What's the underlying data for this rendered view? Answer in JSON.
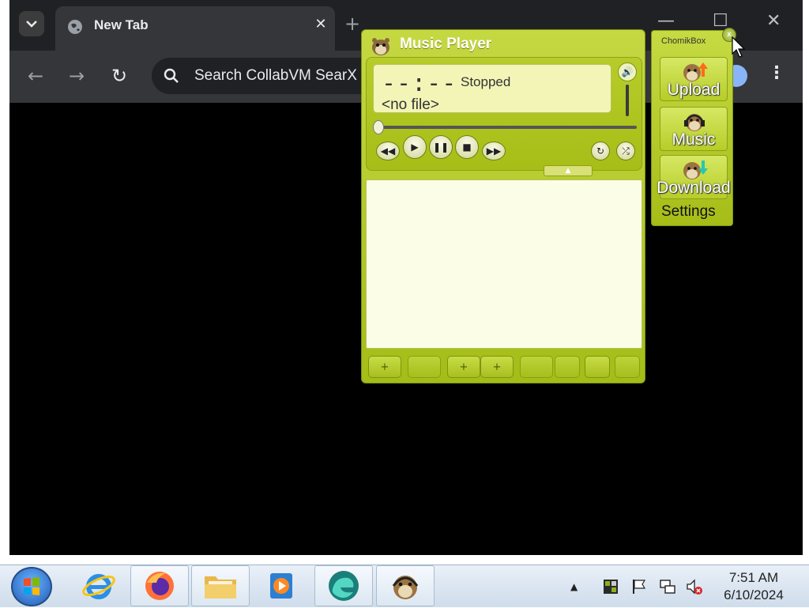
{
  "browser": {
    "tab_title": "New Tab",
    "tab_close": "✕",
    "new_tab": "+",
    "omnibox_text": "Search CollabVM SearX",
    "window_minimize": "—",
    "window_maximize": "☐",
    "window_close": "✕",
    "menu": "⋮",
    "back": "←",
    "forward": "→",
    "reload": "↻"
  },
  "music_player": {
    "title": "Music Player",
    "time": "--:--",
    "status": "Stopped",
    "file": "<no file>",
    "volume_icon": "🔊",
    "controls": {
      "prev": "◀◀",
      "play": "▶",
      "pause": "❚❚",
      "stop": "■",
      "next": "▶▶",
      "repeat": "↻",
      "shuffle": "⤮"
    },
    "collapse": "▲",
    "playlist_buttons": [
      "+",
      "",
      "+",
      "+",
      "",
      "",
      "",
      ""
    ]
  },
  "chomikbox": {
    "title": "ChomikBox",
    "close": "x",
    "upload": "Upload",
    "music": "Music",
    "download": "Download",
    "settings": "Settings"
  },
  "taskbar": {
    "tray_up": "▲",
    "time": "7:51 AM",
    "date": "6/10/2024"
  },
  "colors": {
    "player_green": "#a4bd17",
    "chrome_dark": "#202124",
    "chrome_toolbar": "#35363a"
  }
}
